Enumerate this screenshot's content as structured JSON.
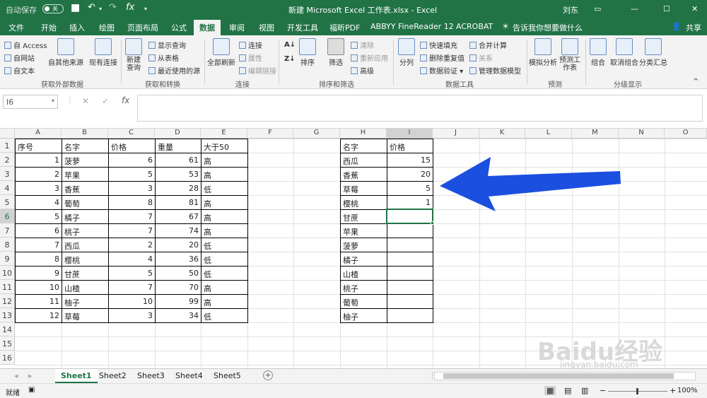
{
  "titlebar": {
    "autosave_label": "自动保存",
    "autosave_state": "关",
    "title": "新建 Microsoft Excel 工作表.xlsx  -  Excel",
    "user": "刘东"
  },
  "tabs": [
    "文件",
    "开始",
    "插入",
    "绘图",
    "页面布局",
    "公式",
    "数据",
    "审阅",
    "视图",
    "开发工具",
    "福昕PDF",
    "ABBYY FineReader 12",
    "ACROBAT"
  ],
  "active_tab": "数据",
  "tell_me": "告诉我你想要做什么",
  "share": "共享",
  "ribbon": {
    "get_external": {
      "label": "获取外部数据",
      "items": [
        "自 Access",
        "自网站",
        "自文本"
      ],
      "other_sources": "自其他来源",
      "existing_conn": "现有连接"
    },
    "get_transform": {
      "label": "获取和转换",
      "new_query": "新建查询",
      "items": [
        "显示查询",
        "从表格",
        "最近使用的源"
      ]
    },
    "connections": {
      "label": "连接",
      "refresh_all": "全部刷新",
      "items": [
        "连接",
        "属性",
        "编辑链接"
      ]
    },
    "sort_filter": {
      "label": "排序和筛选",
      "sort": "排序",
      "filter": "筛选",
      "items": [
        "清除",
        "重新应用",
        "高级"
      ]
    },
    "data_tools": {
      "label": "数据工具",
      "split": "分列",
      "items": [
        "快速填充",
        "删除重复值",
        "数据验证",
        "合并计算",
        "关系",
        "管理数据模型"
      ]
    },
    "forecast": {
      "label": "预测",
      "what_if": "模拟分析",
      "forecast_sheet": "预测工作表"
    },
    "outline": {
      "label": "分级显示",
      "group": "组合",
      "ungroup": "取消组合",
      "subtotal": "分类汇总"
    }
  },
  "namebox": "I6",
  "columns": [
    "A",
    "B",
    "C",
    "D",
    "E",
    "F",
    "G",
    "H",
    "I",
    "J",
    "K",
    "L",
    "M",
    "N",
    "O"
  ],
  "rows": [
    "1",
    "2",
    "3",
    "4",
    "5",
    "6",
    "7",
    "8",
    "9",
    "10",
    "11",
    "12",
    "13",
    "14",
    "15",
    "16"
  ],
  "table1": {
    "headers": [
      "序号",
      "名字",
      "价格",
      "重量",
      "大于50"
    ],
    "rows": [
      [
        "1",
        "菠萝",
        "6",
        "61",
        "高"
      ],
      [
        "2",
        "苹果",
        "5",
        "53",
        "高"
      ],
      [
        "3",
        "香蕉",
        "3",
        "28",
        "低"
      ],
      [
        "4",
        "葡萄",
        "8",
        "81",
        "高"
      ],
      [
        "5",
        "橘子",
        "7",
        "67",
        "高"
      ],
      [
        "6",
        "桃子",
        "7",
        "74",
        "高"
      ],
      [
        "7",
        "西瓜",
        "2",
        "20",
        "低"
      ],
      [
        "8",
        "樱桃",
        "4",
        "36",
        "低"
      ],
      [
        "9",
        "甘蔗",
        "5",
        "50",
        "低"
      ],
      [
        "10",
        "山楂",
        "7",
        "70",
        "高"
      ],
      [
        "11",
        "柚子",
        "10",
        "99",
        "高"
      ],
      [
        "12",
        "草莓",
        "3",
        "34",
        "低"
      ]
    ]
  },
  "table2": {
    "headers": [
      "名字",
      "价格"
    ],
    "rows": [
      [
        "西瓜",
        "15"
      ],
      [
        "香蕉",
        "20"
      ],
      [
        "草莓",
        "5"
      ],
      [
        "樱桃",
        "1"
      ],
      [
        "甘蔗",
        ""
      ],
      [
        "苹果",
        ""
      ],
      [
        "菠萝",
        ""
      ],
      [
        "橘子",
        ""
      ],
      [
        "山楂",
        ""
      ],
      [
        "桃子",
        ""
      ],
      [
        "葡萄",
        ""
      ],
      [
        "柚子",
        ""
      ]
    ]
  },
  "sheets": [
    "Sheet1",
    "Sheet2",
    "Sheet3",
    "Sheet4",
    "Sheet5"
  ],
  "active_sheet": "Sheet1",
  "status": {
    "ready": "就绪",
    "zoom": "100%"
  },
  "watermark": {
    "brand": "Baidu经验",
    "url": "jingyan.baidu.com"
  },
  "colors": {
    "excel_green": "#217346",
    "arrow_blue": "#1a4fe0"
  }
}
